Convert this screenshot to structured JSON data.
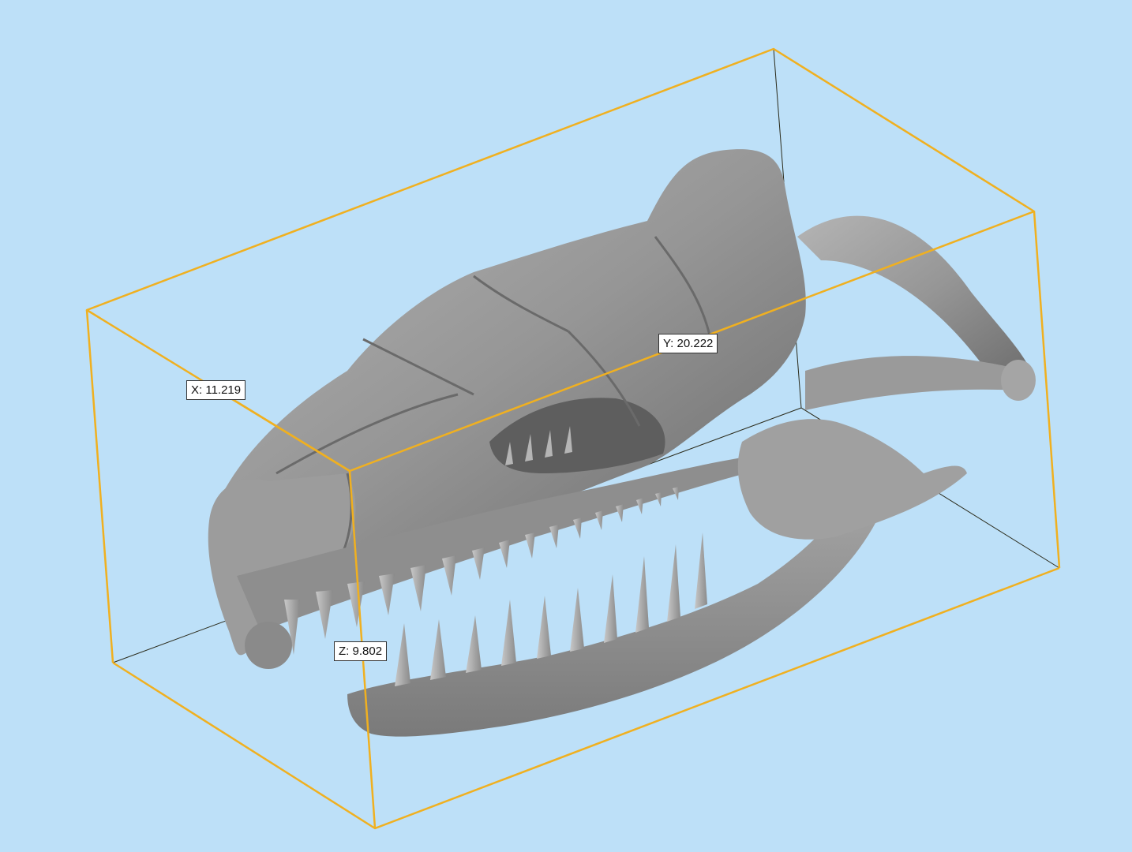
{
  "viewport": {
    "background_color": "#bde0f8",
    "bounding_box_color": "#f0b020",
    "axis_line_color": "#2a2a1a",
    "model_color": "#8f8f8f"
  },
  "dimensions": {
    "x_label": "X: 11.219",
    "y_label": "Y: 20.222",
    "z_label": "Z: 9.802"
  }
}
